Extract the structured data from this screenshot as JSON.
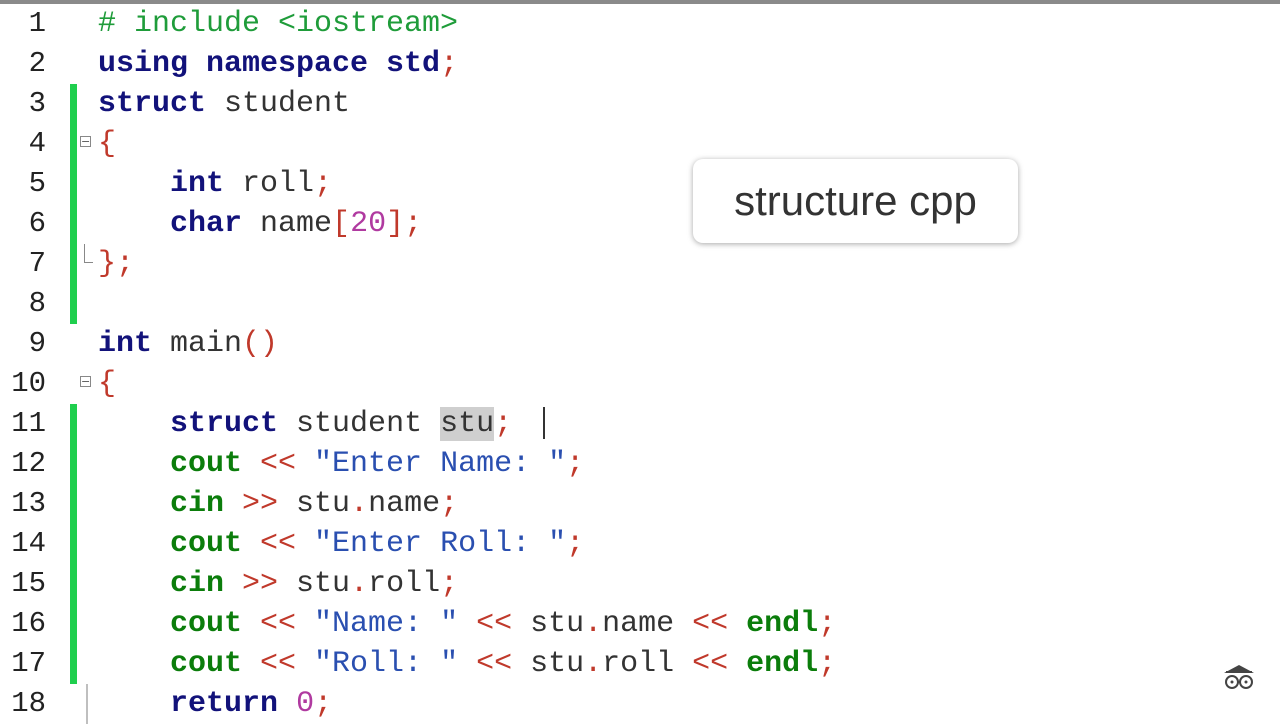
{
  "editor": {
    "lines": [
      {
        "n": "1",
        "tokens": [
          {
            "t": "# include <iostream>",
            "c": "pp"
          }
        ]
      },
      {
        "n": "2",
        "tokens": [
          {
            "t": "using namespace std",
            "c": "k"
          },
          {
            "t": ";",
            "c": "p"
          }
        ]
      },
      {
        "n": "3",
        "tokens": [
          {
            "t": "struct",
            "c": "k"
          },
          {
            "t": " student",
            "c": ""
          }
        ]
      },
      {
        "n": "4",
        "tokens": [
          {
            "t": "{",
            "c": "p"
          }
        ]
      },
      {
        "n": "5",
        "tokens": [
          {
            "t": "    ",
            "c": ""
          },
          {
            "t": "int",
            "c": "k"
          },
          {
            "t": " roll",
            "c": ""
          },
          {
            "t": ";",
            "c": "p"
          }
        ]
      },
      {
        "n": "6",
        "tokens": [
          {
            "t": "    ",
            "c": ""
          },
          {
            "t": "char",
            "c": "k"
          },
          {
            "t": " name",
            "c": ""
          },
          {
            "t": "[",
            "c": "p"
          },
          {
            "t": "20",
            "c": "n"
          },
          {
            "t": "]",
            "c": "p"
          },
          {
            "t": ";",
            "c": "p"
          }
        ]
      },
      {
        "n": "7",
        "tokens": [
          {
            "t": "};",
            "c": "p"
          }
        ]
      },
      {
        "n": "8",
        "tokens": []
      },
      {
        "n": "9",
        "tokens": [
          {
            "t": "int",
            "c": "k"
          },
          {
            "t": " main",
            "c": ""
          },
          {
            "t": "()",
            "c": "p"
          }
        ]
      },
      {
        "n": "10",
        "tokens": [
          {
            "t": "{",
            "c": "p"
          }
        ]
      },
      {
        "n": "11",
        "tokens": [
          {
            "t": "    ",
            "c": ""
          },
          {
            "t": "struct",
            "c": "k"
          },
          {
            "t": " student ",
            "c": ""
          },
          {
            "t": "stu",
            "c": "hl"
          },
          {
            "t": ";",
            "c": "p"
          }
        ]
      },
      {
        "n": "12",
        "tokens": [
          {
            "t": "    ",
            "c": ""
          },
          {
            "t": "cout",
            "c": "kw"
          },
          {
            "t": " << ",
            "c": "p"
          },
          {
            "t": "\"Enter Name: \"",
            "c": "s"
          },
          {
            "t": ";",
            "c": "p"
          }
        ]
      },
      {
        "n": "13",
        "tokens": [
          {
            "t": "    ",
            "c": ""
          },
          {
            "t": "cin",
            "c": "kw"
          },
          {
            "t": " >> ",
            "c": "p"
          },
          {
            "t": "stu",
            "c": ""
          },
          {
            "t": ".",
            "c": "p"
          },
          {
            "t": "name",
            "c": ""
          },
          {
            "t": ";",
            "c": "p"
          }
        ]
      },
      {
        "n": "14",
        "tokens": [
          {
            "t": "    ",
            "c": ""
          },
          {
            "t": "cout",
            "c": "kw"
          },
          {
            "t": " << ",
            "c": "p"
          },
          {
            "t": "\"Enter Roll: \"",
            "c": "s"
          },
          {
            "t": ";",
            "c": "p"
          }
        ]
      },
      {
        "n": "15",
        "tokens": [
          {
            "t": "    ",
            "c": ""
          },
          {
            "t": "cin",
            "c": "kw"
          },
          {
            "t": " >> ",
            "c": "p"
          },
          {
            "t": "stu",
            "c": ""
          },
          {
            "t": ".",
            "c": "p"
          },
          {
            "t": "roll",
            "c": ""
          },
          {
            "t": ";",
            "c": "p"
          }
        ]
      },
      {
        "n": "16",
        "tokens": [
          {
            "t": "    ",
            "c": ""
          },
          {
            "t": "cout",
            "c": "kw"
          },
          {
            "t": " << ",
            "c": "p"
          },
          {
            "t": "\"Name: \"",
            "c": "s"
          },
          {
            "t": " << ",
            "c": "p"
          },
          {
            "t": "stu",
            "c": ""
          },
          {
            "t": ".",
            "c": "p"
          },
          {
            "t": "name",
            "c": ""
          },
          {
            "t": " << ",
            "c": "p"
          },
          {
            "t": "endl",
            "c": "kw"
          },
          {
            "t": ";",
            "c": "p"
          }
        ]
      },
      {
        "n": "17",
        "tokens": [
          {
            "t": "    ",
            "c": ""
          },
          {
            "t": "cout",
            "c": "kw"
          },
          {
            "t": " << ",
            "c": "p"
          },
          {
            "t": "\"Roll: \"",
            "c": "s"
          },
          {
            "t": " << ",
            "c": "p"
          },
          {
            "t": "stu",
            "c": ""
          },
          {
            "t": ".",
            "c": "p"
          },
          {
            "t": "roll",
            "c": ""
          },
          {
            "t": " << ",
            "c": "p"
          },
          {
            "t": "endl",
            "c": "kw"
          },
          {
            "t": ";",
            "c": "p"
          }
        ]
      },
      {
        "n": "18",
        "tokens": [
          {
            "t": "    ",
            "c": ""
          },
          {
            "t": "return",
            "c": "k"
          },
          {
            "t": " ",
            "c": ""
          },
          {
            "t": "0",
            "c": "n"
          },
          {
            "t": ";",
            "c": "p"
          }
        ]
      }
    ]
  },
  "tooltip": {
    "text": "structure cpp"
  },
  "colors": {
    "changed_gutter": "#1fcf4e",
    "keyword": "#12127a",
    "stream_keyword": "#0b7d0b",
    "operator": "#c0392b",
    "string": "#2a4fb0",
    "number": "#b03aa0",
    "preprocessor": "#1f9c3a"
  },
  "icons": {
    "watermark": "nerd-glasses-icon"
  }
}
